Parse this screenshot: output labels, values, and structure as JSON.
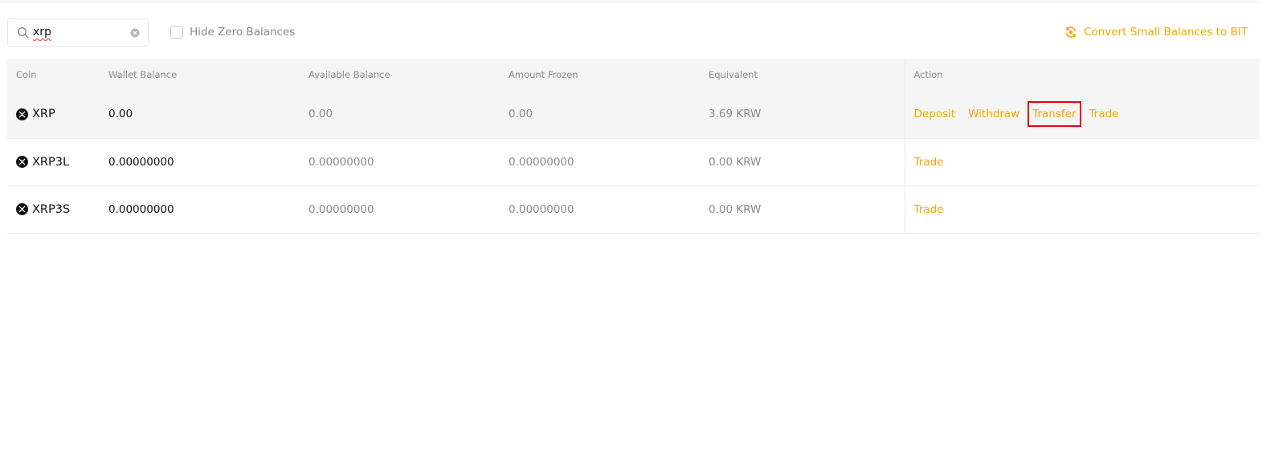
{
  "toolbar": {
    "search_value": "xrp",
    "hide_zero_label": "Hide Zero Balances",
    "convert_label": "Convert Small Balances to BIT"
  },
  "table": {
    "headers": {
      "coin": "Coin",
      "wallet": "Wallet Balance",
      "available": "Available Balance",
      "frozen": "Amount Frozen",
      "equivalent": "Equivalent",
      "action": "Action"
    },
    "rows": [
      {
        "coin": "XRP",
        "wallet": "0.00",
        "available": "0.00",
        "frozen": "0.00",
        "equivalent": "3.69 KRW",
        "actions": {
          "deposit": "Deposit",
          "withdraw": "Withdraw",
          "transfer": "Transfer",
          "trade": "Trade"
        }
      },
      {
        "coin": "XRP3L",
        "wallet": "0.00000000",
        "available": "0.00000000",
        "frozen": "0.00000000",
        "equivalent": "0.00 KRW",
        "actions": {
          "trade": "Trade"
        }
      },
      {
        "coin": "XRP3S",
        "wallet": "0.00000000",
        "available": "0.00000000",
        "frozen": "0.00000000",
        "equivalent": "0.00 KRW",
        "actions": {
          "trade": "Trade"
        }
      }
    ]
  },
  "colors": {
    "accent": "#f7a600",
    "highlight": "#e60012",
    "header_bg": "#f5f5f5"
  },
  "icons": {
    "search": "search-icon",
    "clear": "clear-icon",
    "convert": "convert-icon",
    "coin": "xrp-coin-icon"
  }
}
